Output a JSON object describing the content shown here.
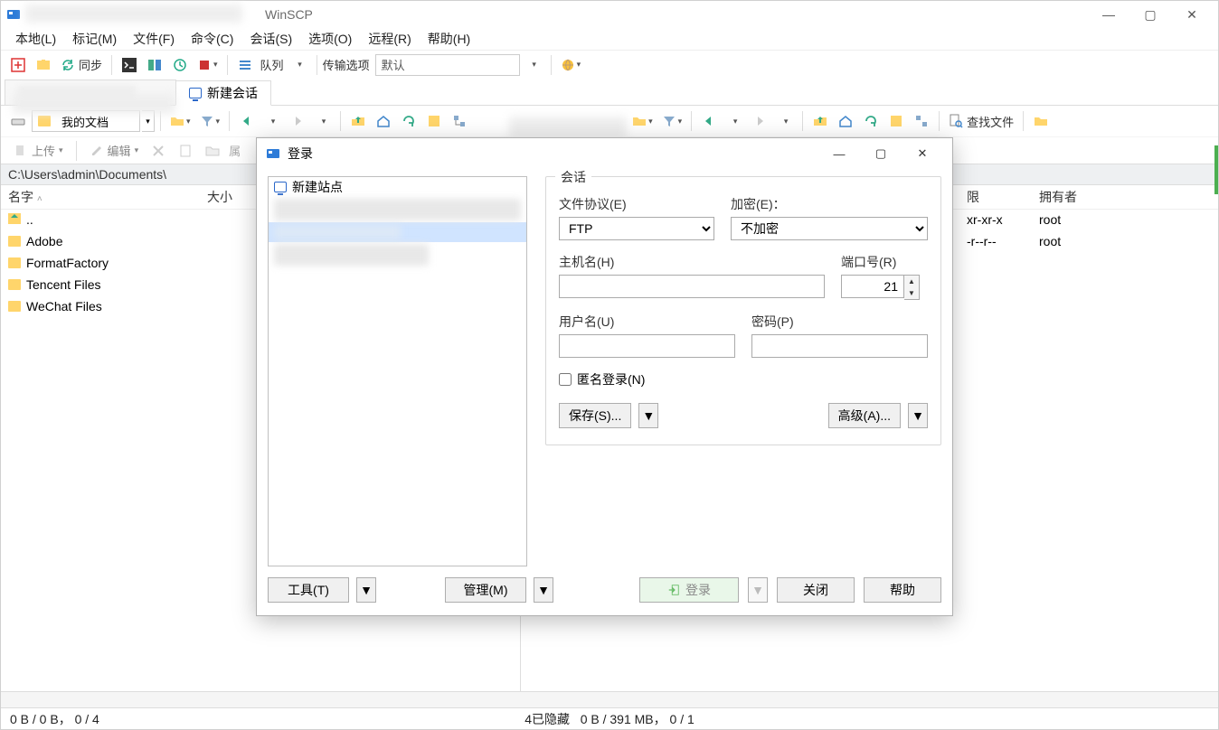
{
  "window": {
    "title": "WinSCP",
    "controls": {
      "min": "—",
      "max": "▢",
      "close": "✕"
    }
  },
  "menu": {
    "local": "本地(L)",
    "mark": "标记(M)",
    "files": "文件(F)",
    "commands": "命令(C)",
    "session": "会话(S)",
    "options": "选项(O)",
    "remote": "远程(R)",
    "help": "帮助(H)"
  },
  "toolbar1": {
    "sync": "同步",
    "queue": "队列",
    "transfer_label": "传输选项",
    "transfer_value": "默认"
  },
  "tabs": {
    "new_session": "新建会话"
  },
  "nav": {
    "local_folder": "我的文档",
    "find_files": "查找文件"
  },
  "filetools": {
    "upload": "上传",
    "edit": "编辑",
    "props": "属"
  },
  "left": {
    "path": "C:\\Users\\admin\\Documents\\",
    "cols": {
      "name": "名字",
      "size": "大小"
    },
    "items": [
      {
        "name": "..",
        "up": true
      },
      {
        "name": "Adobe"
      },
      {
        "name": "FormatFactory"
      },
      {
        "name": "Tencent Files"
      },
      {
        "name": "WeChat Files"
      }
    ]
  },
  "right": {
    "cols": {
      "perm": "限",
      "owner": "拥有者"
    },
    "rows": [
      {
        "perm": "xr-xr-x",
        "owner": "root"
      },
      {
        "perm": "-r--r--",
        "owner": "root"
      }
    ]
  },
  "status": {
    "left": "0 B / 0 B， 0 / 4",
    "mid": "4已隐藏",
    "right": "0 B / 391 MB， 0 / 1"
  },
  "dialog": {
    "title": "登录",
    "new_site": "新建站点",
    "session_legend": "会话",
    "file_protocol_label": "文件协议(E)",
    "file_protocol_value": "FTP",
    "encryption_label": "加密(E)：",
    "encryption_value": "不加密",
    "host_label": "主机名(H)",
    "port_label": "端口号(R)",
    "port_value": "21",
    "user_label": "用户名(U)",
    "pass_label": "密码(P)",
    "anon_label": "匿名登录(N)",
    "save_btn": "保存(S)...",
    "advanced_btn": "高级(A)...",
    "tools_btn": "工具(T)",
    "manage_btn": "管理(M)",
    "login_btn": "登录",
    "close_btn": "关闭",
    "help_btn": "帮助"
  }
}
